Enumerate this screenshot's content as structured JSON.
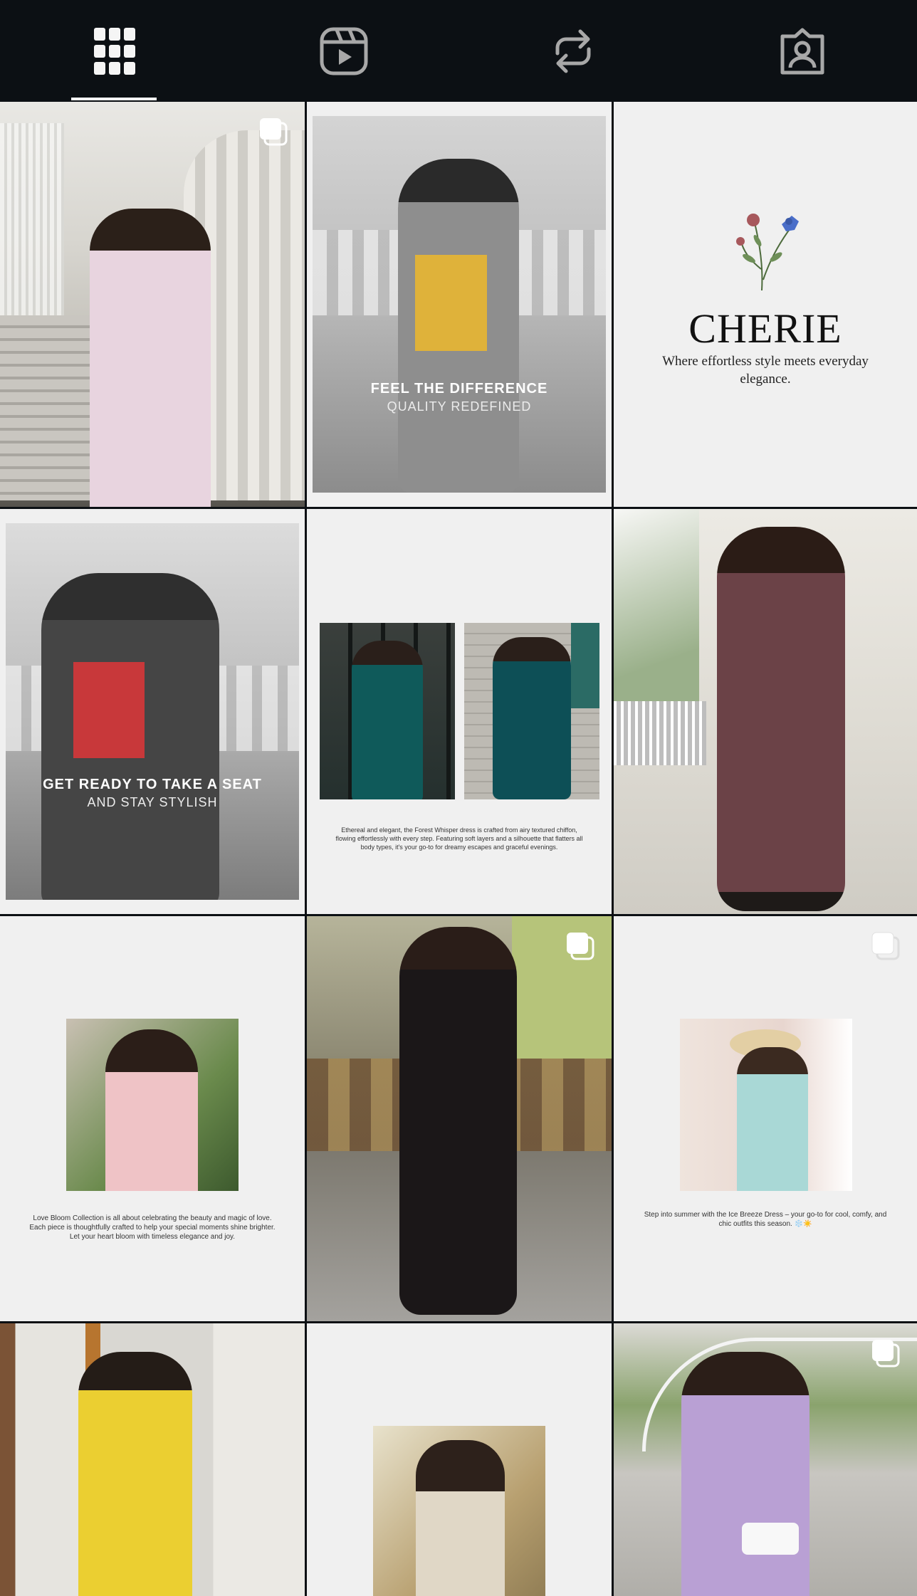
{
  "tabs": [
    {
      "id": "grid",
      "icon": "grid-icon",
      "active": true
    },
    {
      "id": "reels",
      "icon": "reels-icon",
      "active": false
    },
    {
      "id": "reposts",
      "icon": "repost-icon",
      "active": false
    },
    {
      "id": "tagged",
      "icon": "tagged-user-icon",
      "active": false
    }
  ],
  "colors": {
    "background": "#0c1014",
    "icon_active": "#f5f5f5",
    "icon_inactive": "#a8a8a8",
    "tile_light": "#f0f0f0"
  },
  "posts": {
    "post2": {
      "title": "FEEL THE DIFFERENCE",
      "subtitle": "QUALITY REDEFINED"
    },
    "post3": {
      "brand": "CHERIE",
      "tagline": "Where effortless style meets everyday elegance."
    },
    "post4": {
      "title": "GET READY TO TAKE A SEAT",
      "subtitle": "AND STAY STYLISH"
    },
    "post5": {
      "caption": "Ethereal and elegant, the Forest Whisper dress is crafted from airy textured chiffon, flowing effortlessly with every step. Featuring soft layers and a silhouette that flatters all body types, it's your go-to for dreamy escapes and graceful evenings."
    },
    "post7": {
      "caption": "Love Bloom Collection is all about celebrating the beauty and magic of love. Each piece is thoughtfully crafted to help your special moments shine brighter. Let your heart bloom with timeless elegance and joy."
    },
    "post9": {
      "caption": "Step into summer with the Ice Breeze Dress – your go-to for cool, comfy, and chic outfits this season. ❄️☀️"
    }
  }
}
